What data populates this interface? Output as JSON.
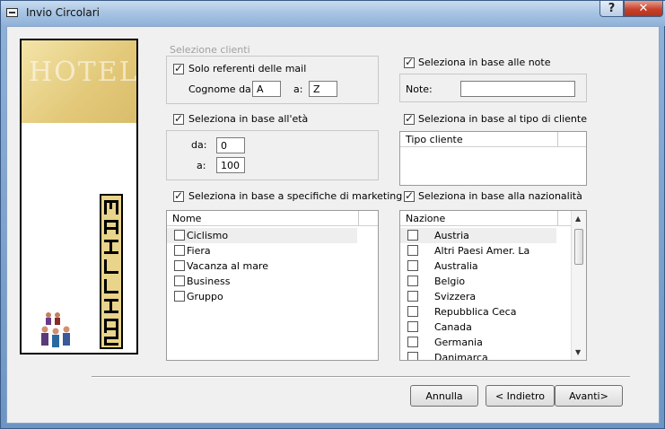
{
  "window": {
    "title": "Invio Circolari",
    "help_glyph": "?",
    "close_glyph": "✕"
  },
  "banner": {
    "hotel_text": "HOTEL",
    "vertical_text": "MAILING"
  },
  "clients": {
    "group_label": "Selezione clienti",
    "mail_refs_label": "Solo referenti delle mail",
    "mail_refs_checked": true,
    "surname_from_label": "Cognome da:",
    "surname_from_value": "A",
    "surname_to_label": "a:",
    "surname_to_value": "Z"
  },
  "age": {
    "label": "Seleziona in base all'età",
    "checked": true,
    "from_label": "da:",
    "from_value": "0",
    "to_label": "a:",
    "to_value": "100"
  },
  "marketing": {
    "label": "Seleziona in base a specifiche di marketing",
    "checked": true,
    "column": "Nome",
    "items": [
      "Ciclismo",
      "Fiera",
      "Vacanza al mare",
      "Business",
      "Gruppo"
    ]
  },
  "notes": {
    "label": "Seleziona in base alle note",
    "checked": true,
    "field_label": "Note:",
    "field_value": ""
  },
  "client_type": {
    "label": "Seleziona in base al tipo di cliente",
    "checked": true,
    "column": "Tipo cliente"
  },
  "nationality": {
    "label": "Seleziona in base alla nazionalità",
    "checked": true,
    "column": "Nazione",
    "items": [
      "Austria",
      "Altri Paesi Amer. La",
      "Australia",
      "Belgio",
      "Svizzera",
      "Repubblica Ceca",
      "Canada",
      "Germania",
      "Danimarca"
    ]
  },
  "buttons": {
    "cancel": "Annulla",
    "back": "< Indietro",
    "next": "Avanti>"
  }
}
